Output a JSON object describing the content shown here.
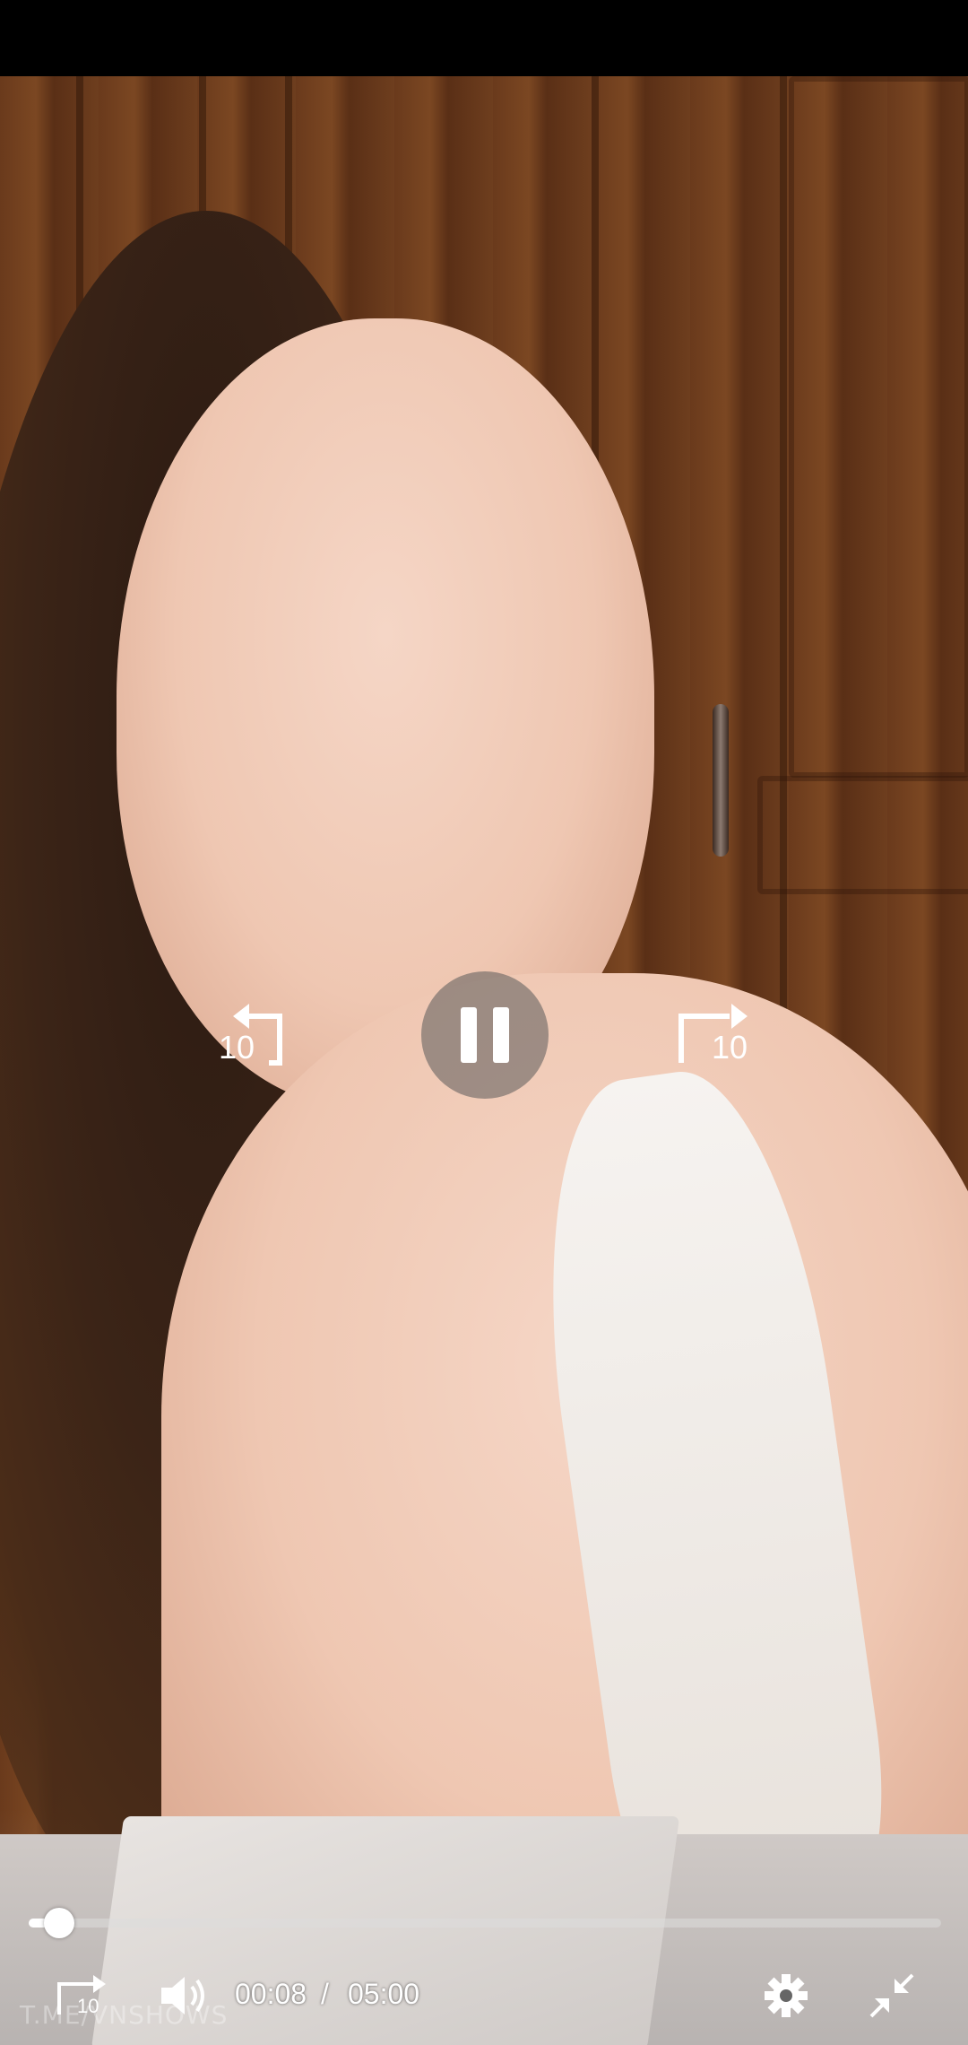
{
  "player": {
    "skip_back_label": "10",
    "skip_forward_label": "10",
    "small_skip_label": "10",
    "current_time": "00:08",
    "separator": "/",
    "duration": "05:00",
    "progress_fraction": 0.027,
    "watermark": "T.ME/VNSHOWS",
    "state": "playing"
  },
  "icons": {
    "pause": "pause-icon",
    "skip_back": "replay-10-icon",
    "skip_forward": "forward-10-icon",
    "small_skip": "forward-10-icon",
    "volume": "volume-icon",
    "settings": "gear-icon",
    "exit_fullscreen": "exit-fullscreen-icon"
  },
  "colors": {
    "controls": "#ffffff",
    "track": "#dcdcdc",
    "top_bar": "#000000"
  }
}
